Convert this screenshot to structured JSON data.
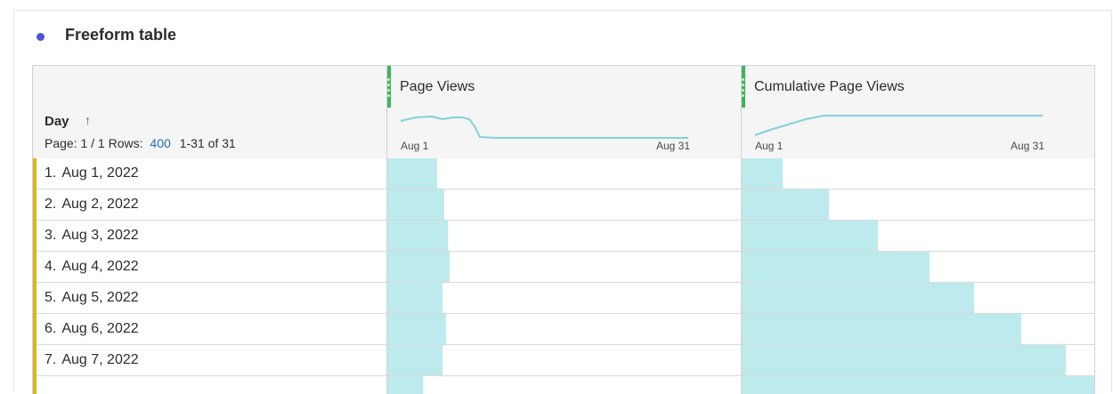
{
  "panel": {
    "title": "Freeform table"
  },
  "table": {
    "dimension": {
      "label": "Day",
      "sort": "ascending"
    },
    "paging": {
      "page_label": "Page: 1 / 1",
      "rows_label": "Rows:",
      "rows_value": "400",
      "range": "1-31 of 31"
    },
    "metrics": [
      {
        "name": "Page Views",
        "spark_start": "Aug 1",
        "spark_end": "Aug 31"
      },
      {
        "name": "Cumulative Page Views",
        "spark_start": "Aug 1",
        "spark_end": "Aug 31"
      }
    ],
    "rows": [
      {
        "num": "1.",
        "day": "Aug 1, 2022",
        "page_views_fraction": 0.14,
        "cumulative_fraction": 0.115
      },
      {
        "num": "2.",
        "day": "Aug 2, 2022",
        "page_views_fraction": 0.16,
        "cumulative_fraction": 0.245
      },
      {
        "num": "3.",
        "day": "Aug 3, 2022",
        "page_views_fraction": 0.17,
        "cumulative_fraction": 0.385
      },
      {
        "num": "4.",
        "day": "Aug 4, 2022",
        "page_views_fraction": 0.175,
        "cumulative_fraction": 0.53
      },
      {
        "num": "5.",
        "day": "Aug 5, 2022",
        "page_views_fraction": 0.155,
        "cumulative_fraction": 0.655
      },
      {
        "num": "6.",
        "day": "Aug 6, 2022",
        "page_views_fraction": 0.165,
        "cumulative_fraction": 0.789
      },
      {
        "num": "7.",
        "day": "Aug 7, 2022",
        "page_views_fraction": 0.155,
        "cumulative_fraction": 0.915
      },
      {
        "num": "",
        "day": "",
        "page_views_fraction": 0.1,
        "cumulative_fraction": 1.0
      }
    ]
  },
  "colors": {
    "accent_dot": "#4f54d6",
    "metric_grip": "#3fb35a",
    "row_marker": "#d8b817",
    "bar": "#bdeaed",
    "sparkline": "#7fd3d9",
    "link": "#1f6fb5"
  }
}
